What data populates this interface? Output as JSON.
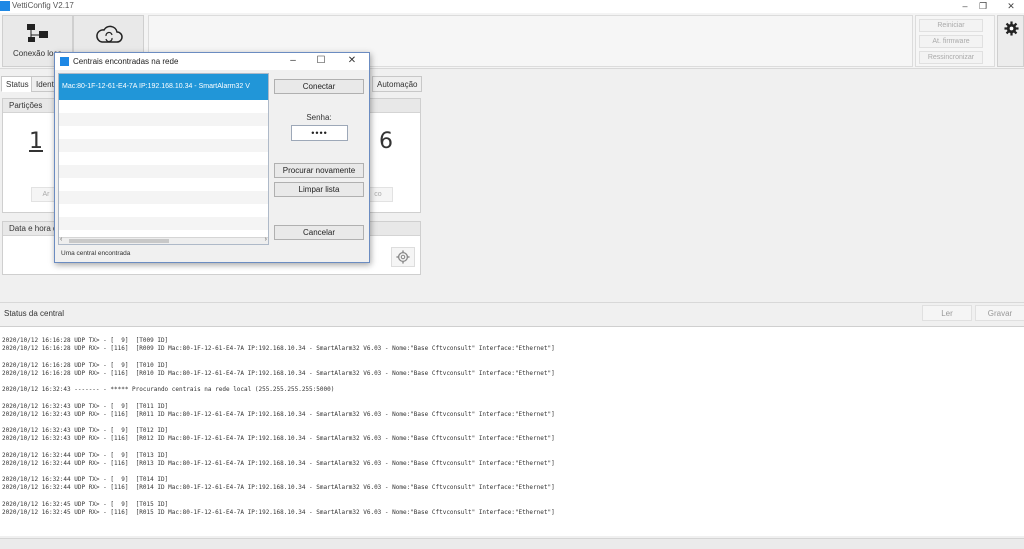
{
  "window": {
    "title": "VettiConfig V2.17"
  },
  "toolbar": {
    "connect_label": "Conexão loca"
  },
  "side_commands": {
    "restart": "Reiniciar",
    "firmware": "At. firmware",
    "resync": "Ressincronizar"
  },
  "tabs": {
    "status": "Status",
    "ident": "Ident",
    "automation": "Automação"
  },
  "panels": {
    "partitions": {
      "title": "Partições",
      "count": "1",
      "btn": "Ar"
    },
    "right_count": "6",
    "right_btn": "co",
    "datetime": {
      "title": "Data e hora d"
    }
  },
  "status_bar": {
    "label": "Status da central",
    "read": "Ler",
    "write": "Gravar"
  },
  "log_lines": [
    "2020/10/12 16:16:28 UDP TX> - [  9]  [T009 ID]",
    "2020/10/12 16:16:28 UDP RX> - [116]  [R009 ID Mac:80-1F-12-61-E4-7A IP:192.168.10.34 - SmartAlarm32 V6.03 - Nome:\"Base Cftvconsult\" Interface:\"Ethernet\"]",
    "",
    "2020/10/12 16:16:28 UDP TX> - [  9]  [T010 ID]",
    "2020/10/12 16:16:28 UDP RX> - [116]  [R010 ID Mac:80-1F-12-61-E4-7A IP:192.168.10.34 - SmartAlarm32 V6.03 - Nome:\"Base Cftvconsult\" Interface:\"Ethernet\"]",
    "",
    "2020/10/12 16:32:43 ------- - ***** Procurando centrais na rede local (255.255.255.255:5000)",
    "",
    "2020/10/12 16:32:43 UDP TX> - [  9]  [T011 ID]",
    "2020/10/12 16:32:43 UDP RX> - [116]  [R011 ID Mac:80-1F-12-61-E4-7A IP:192.168.10.34 - SmartAlarm32 V6.03 - Nome:\"Base Cftvconsult\" Interface:\"Ethernet\"]",
    "",
    "2020/10/12 16:32:43 UDP TX> - [  9]  [T012 ID]",
    "2020/10/12 16:32:43 UDP RX> - [116]  [R012 ID Mac:80-1F-12-61-E4-7A IP:192.168.10.34 - SmartAlarm32 V6.03 - Nome:\"Base Cftvconsult\" Interface:\"Ethernet\"]",
    "",
    "2020/10/12 16:32:44 UDP TX> - [  9]  [T013 ID]",
    "2020/10/12 16:32:44 UDP RX> - [116]  [R013 ID Mac:80-1F-12-61-E4-7A IP:192.168.10.34 - SmartAlarm32 V6.03 - Nome:\"Base Cftvconsult\" Interface:\"Ethernet\"]",
    "",
    "2020/10/12 16:32:44 UDP TX> - [  9]  [T014 ID]",
    "2020/10/12 16:32:44 UDP RX> - [116]  [R014 ID Mac:80-1F-12-61-E4-7A IP:192.168.10.34 - SmartAlarm32 V6.03 - Nome:\"Base Cftvconsult\" Interface:\"Ethernet\"]",
    "",
    "2020/10/12 16:32:45 UDP TX> - [  9]  [T015 ID]",
    "2020/10/12 16:32:45 UDP RX> - [116]  [R015 ID Mac:80-1F-12-61-E4-7A IP:192.168.10.34 - SmartAlarm32 V6.03 - Nome:\"Base Cftvconsult\" Interface:\"Ethernet\"]"
  ],
  "dialog": {
    "title": "Centrais encontradas na rede",
    "selected_item": "Mac:80-1F-12-61-E4-7A IP:192.168.10.34 - SmartAlarm32 V",
    "connect": "Conectar",
    "password_label": "Senha:",
    "password_value": "••••",
    "search_again": "Procurar novamente",
    "clear_list": "Limpar lista",
    "cancel": "Cancelar",
    "status": "Uma central encontrada"
  }
}
